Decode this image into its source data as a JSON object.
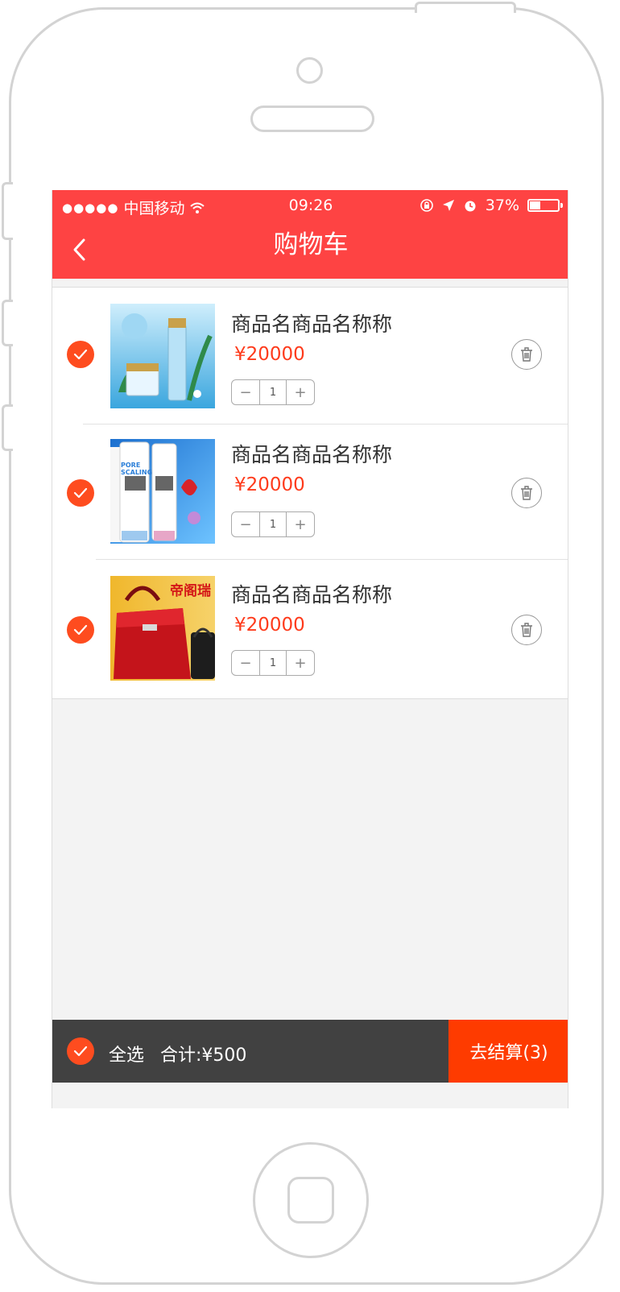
{
  "status_bar": {
    "signal_dots": "●●●●●",
    "carrier": "中国移动",
    "time": "09:26",
    "battery": "37%",
    "battery_level": 0.37
  },
  "header": {
    "title": "购物车",
    "back_icon": "chevron-left-icon"
  },
  "cart": {
    "items": [
      {
        "name": "商品名商品名称称",
        "price": "¥20000",
        "quantity": "1",
        "checked": true,
        "image": "cosmetics-bottles",
        "thumb_text": ""
      },
      {
        "name": "商品名商品名称称",
        "price": "¥20000",
        "quantity": "1",
        "checked": true,
        "image": "pore-scaling-tubes",
        "thumb_text": "PORE SCALING"
      },
      {
        "name": "商品名商品名称称",
        "price": "¥20000",
        "quantity": "1",
        "checked": true,
        "image": "red-handbag",
        "thumb_text": "帝阁瑞"
      }
    ]
  },
  "footer": {
    "select_all": "全选",
    "total": "合计:¥500",
    "checkout": "去结算(3)"
  },
  "colors": {
    "primary": "#fe4343",
    "accent": "#fe4c1f",
    "price": "#fe3b1c",
    "footer_bg": "#414141",
    "checkout_bg": "#fe3b00"
  }
}
